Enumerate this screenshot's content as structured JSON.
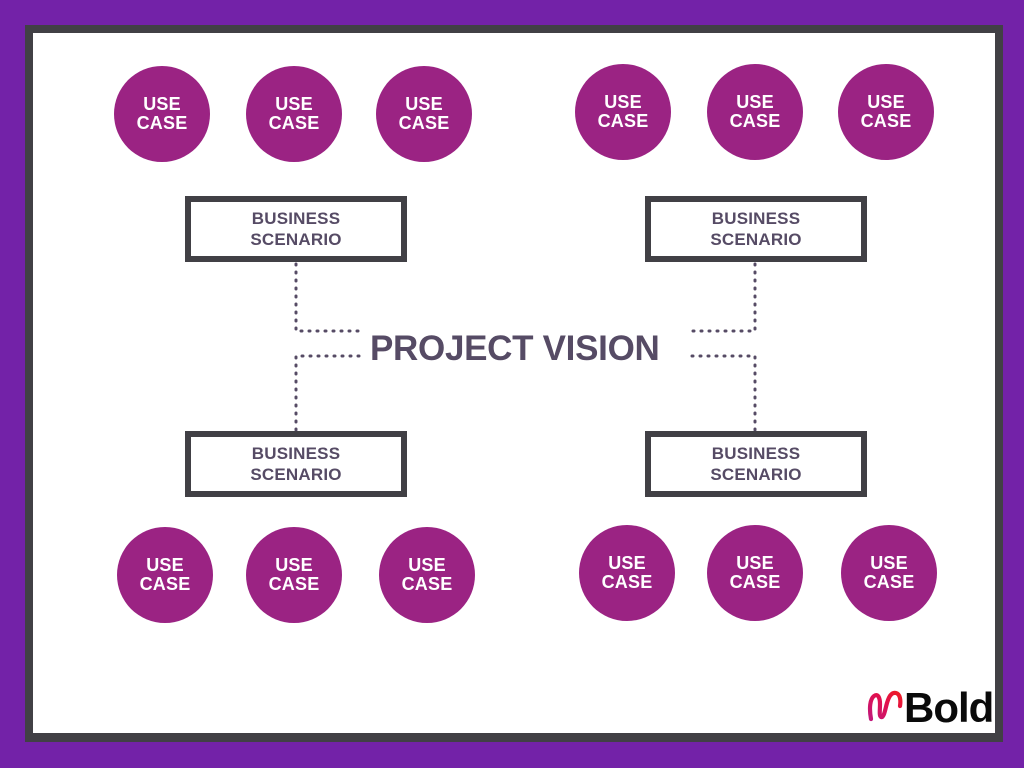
{
  "slide": {
    "background_color": "#7322A8",
    "frame_color": "#414045",
    "canvas_color": "#FFFFFF"
  },
  "theme": {
    "circle_color": "#9B2383",
    "circle_text_color": "#FFFFFF",
    "box_border_color": "#414045",
    "text_color": "#564B65",
    "connector_color": "#564B65"
  },
  "center": {
    "title": "PROJECT VISION"
  },
  "use_cases": [
    {
      "id": "top-left-1",
      "line1": "USE",
      "line2": "CASE"
    },
    {
      "id": "top-left-2",
      "line1": "USE",
      "line2": "CASE"
    },
    {
      "id": "top-left-3",
      "line1": "USE",
      "line2": "CASE"
    },
    {
      "id": "top-right-1",
      "line1": "USE",
      "line2": "CASE"
    },
    {
      "id": "top-right-2",
      "line1": "USE",
      "line2": "CASE"
    },
    {
      "id": "top-right-3",
      "line1": "USE",
      "line2": "CASE"
    },
    {
      "id": "bottom-left-1",
      "line1": "USE",
      "line2": "CASE"
    },
    {
      "id": "bottom-left-2",
      "line1": "USE",
      "line2": "CASE"
    },
    {
      "id": "bottom-left-3",
      "line1": "USE",
      "line2": "CASE"
    },
    {
      "id": "bottom-right-1",
      "line1": "USE",
      "line2": "CASE"
    },
    {
      "id": "bottom-right-2",
      "line1": "USE",
      "line2": "CASE"
    },
    {
      "id": "bottom-right-3",
      "line1": "USE",
      "line2": "CASE"
    }
  ],
  "scenarios": [
    {
      "id": "top-left",
      "line1": "BUSINESS",
      "line2": "SCENARIO"
    },
    {
      "id": "top-right",
      "line1": "BUSINESS",
      "line2": "SCENARIO"
    },
    {
      "id": "bottom-left",
      "line1": "BUSINESS",
      "line2": "SCENARIO"
    },
    {
      "id": "bottom-right",
      "line1": "BUSINESS",
      "line2": "SCENARIO"
    }
  ],
  "logo": {
    "script_letter": "n",
    "word": "Bold",
    "gradient_start": "#C2187B",
    "gradient_end": "#EE1C25",
    "word_color": "#0A0A0A"
  }
}
